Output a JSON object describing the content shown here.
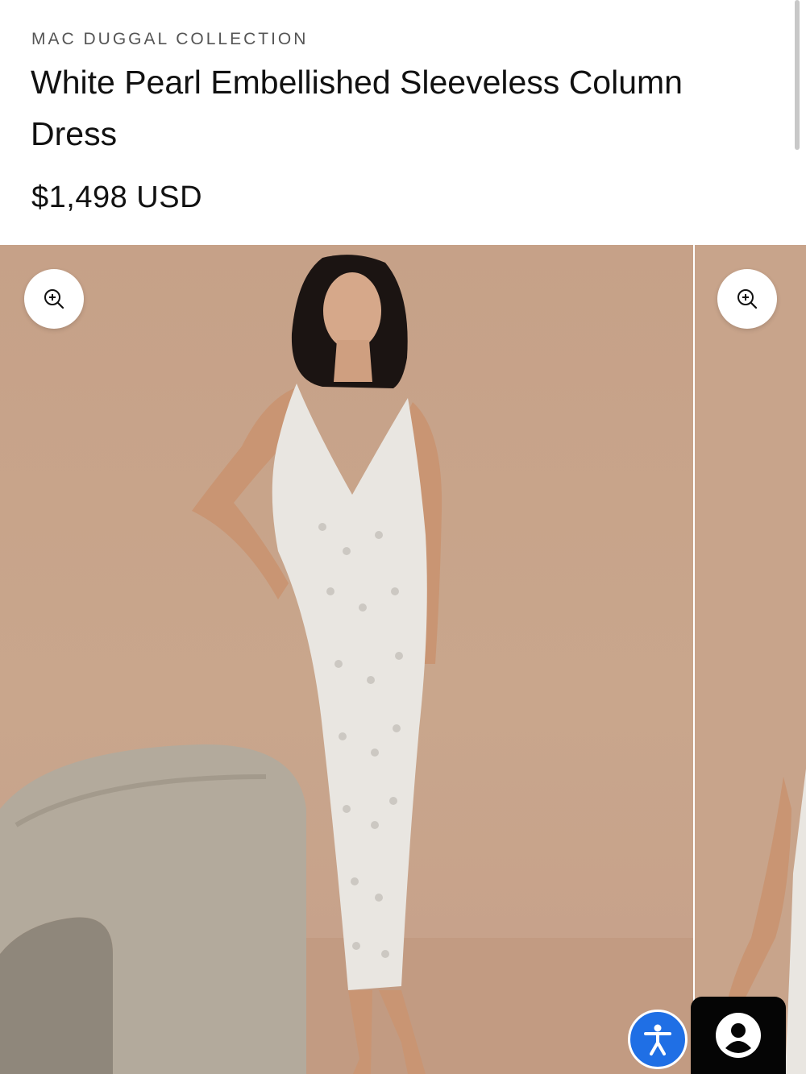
{
  "product": {
    "brand": "MAC DUGGAL COLLECTION",
    "title": "White Pearl Embellished Sleeveless Column Dress",
    "price": "$1,498 USD"
  },
  "gallery": {
    "main_image_alt": "Model wearing white pearl embellished sleeveless column dress beside a boucle chair",
    "next_image_alt": "Next product image preview"
  },
  "icons": {
    "zoom": "zoom-in-icon",
    "accessibility": "accessibility-icon",
    "account": "account-icon"
  },
  "colors": {
    "backdrop": "#c8a48b",
    "accessibility_blue": "#1f6fe5",
    "account_bg": "#050505"
  }
}
